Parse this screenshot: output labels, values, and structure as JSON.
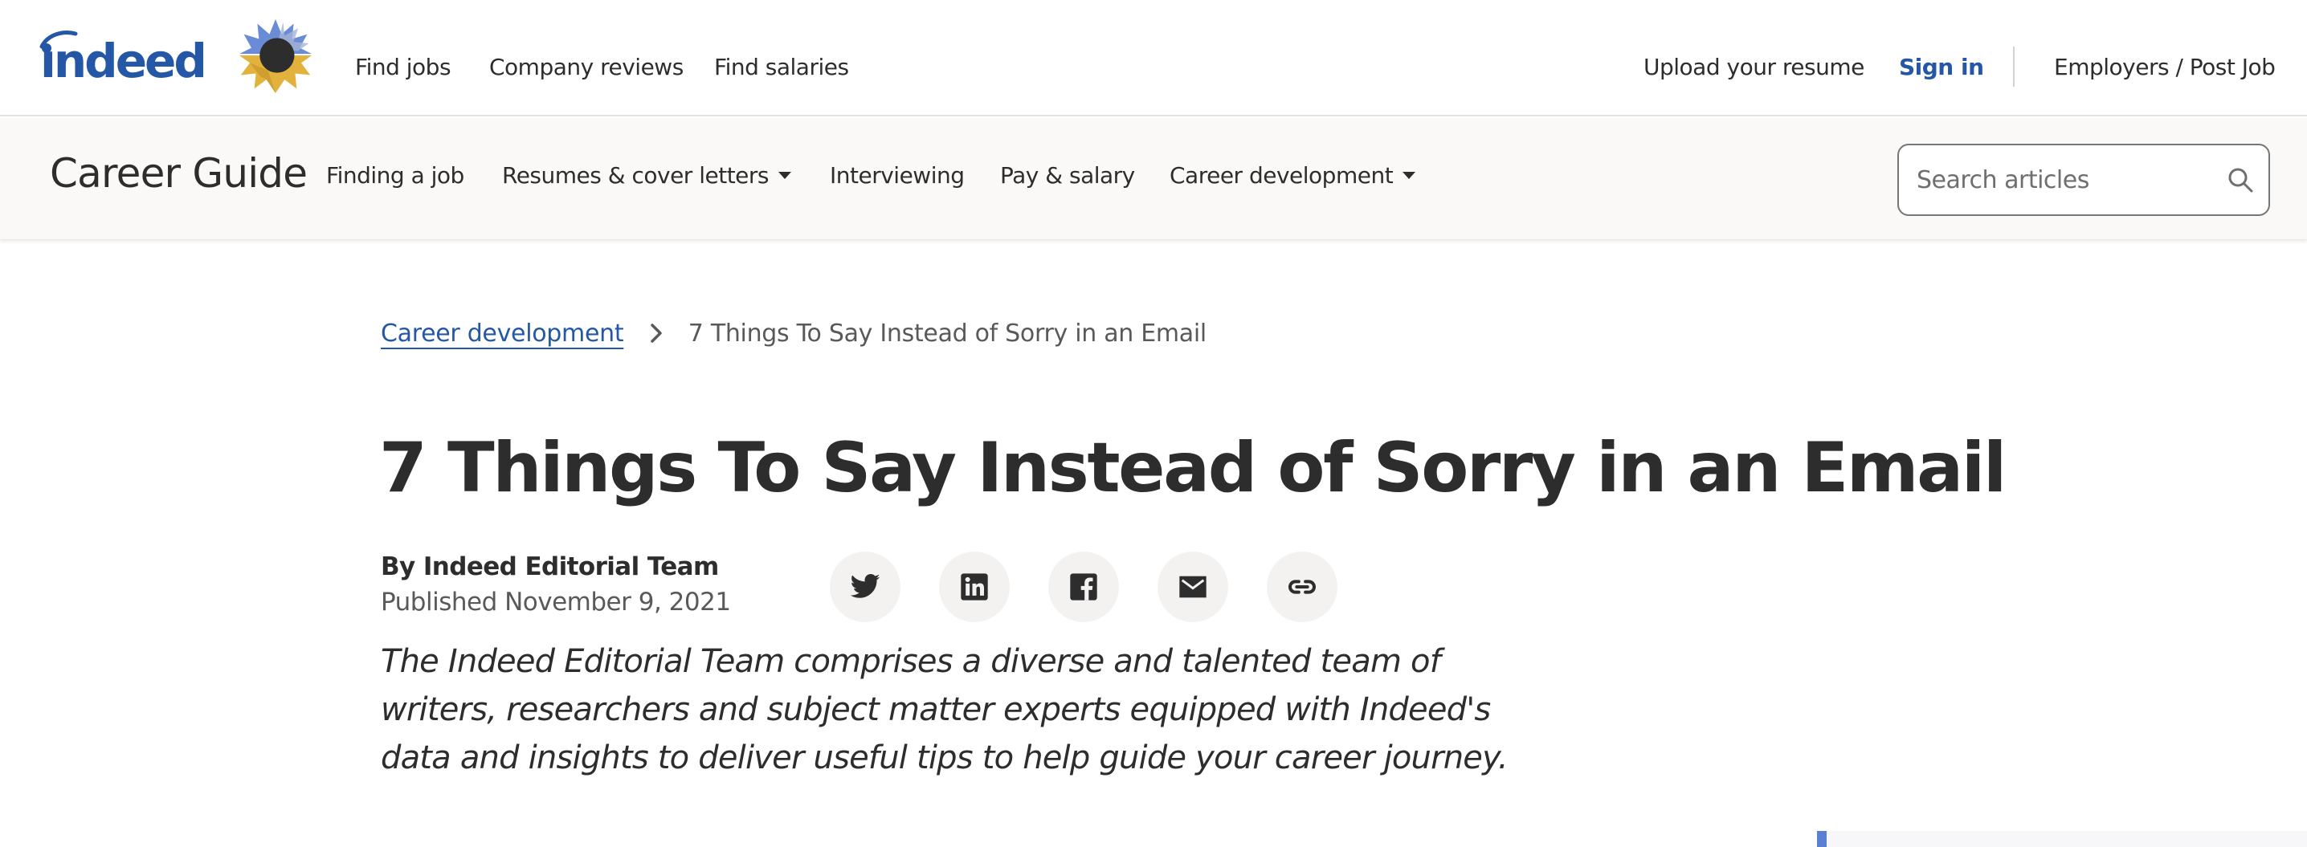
{
  "global_header": {
    "logo_alt": "indeed",
    "brand_color": "#2557a7",
    "nav_left": [
      "Find jobs",
      "Company reviews",
      "Find salaries"
    ],
    "upload_resume": "Upload your resume",
    "sign_in": "Sign in",
    "employers": "Employers / Post Job"
  },
  "sub_header": {
    "title": "Career Guide",
    "nav": [
      {
        "label": "Finding a job",
        "has_dropdown": false
      },
      {
        "label": "Resumes & cover letters",
        "has_dropdown": true
      },
      {
        "label": "Interviewing",
        "has_dropdown": false
      },
      {
        "label": "Pay & salary",
        "has_dropdown": false
      },
      {
        "label": "Career development",
        "has_dropdown": true
      }
    ],
    "search": {
      "placeholder": "Search articles",
      "value": "",
      "icon": "search-icon"
    }
  },
  "breadcrumb": {
    "parent": "Career development",
    "separator_icon": "chevron-right-icon",
    "current": "7 Things To Say Instead of Sorry in an Email"
  },
  "article": {
    "title": "7 Things To Say Instead of Sorry in an Email",
    "author": "By Indeed Editorial Team",
    "published": "Published November 9, 2021",
    "share_buttons": [
      {
        "name": "twitter",
        "icon": "twitter-icon"
      },
      {
        "name": "linkedin",
        "icon": "linkedin-icon"
      },
      {
        "name": "facebook",
        "icon": "facebook-icon"
      },
      {
        "name": "email",
        "icon": "email-icon"
      },
      {
        "name": "copy-link",
        "icon": "link-icon"
      }
    ],
    "author_bio": "The Indeed Editorial Team comprises a diverse and talented team of writers, researchers and subject matter experts equipped with Indeed's data and insights to deliver useful tips to help guide your career journey."
  },
  "colors": {
    "text_primary": "#2d2d2d",
    "text_secondary": "#595959",
    "link": "#2557a7",
    "subheader_bg": "#faf9f8",
    "share_bg": "#f3f2f1"
  }
}
